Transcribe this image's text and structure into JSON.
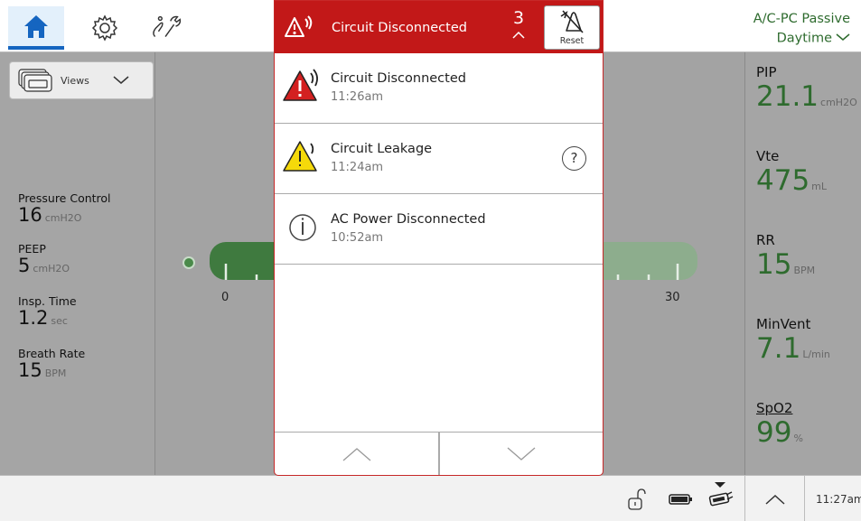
{
  "header": {
    "mode_name": "A/C-PC Passive",
    "schedule": "Daytime",
    "icons": [
      "home-icon",
      "settings-gear-icon",
      "tools-icon"
    ]
  },
  "views": {
    "label": "Views"
  },
  "parameters": [
    {
      "label": "Pressure Control",
      "value": "16",
      "unit": "cmH2O"
    },
    {
      "label": "PEEP",
      "value": "5",
      "unit": "cmH2O"
    },
    {
      "label": "Insp. Time",
      "value": "1.2",
      "unit": "sec"
    },
    {
      "label": "Breath Rate",
      "value": "15",
      "unit": "BPM"
    }
  ],
  "scale": {
    "min": "0",
    "max": "30"
  },
  "measurements": [
    {
      "label": "PIP",
      "value": "21.1",
      "unit": "cmH2O"
    },
    {
      "label": "Vte",
      "value": "475",
      "unit": "mL"
    },
    {
      "label": "RR",
      "value": "15",
      "unit": "BPM"
    },
    {
      "label": "MinVent",
      "value": "7.1",
      "unit": "L/min"
    },
    {
      "label": "SpO2",
      "value": "99",
      "unit": "%"
    }
  ],
  "alarm_panel": {
    "title": "Circuit Disconnected",
    "count": "3",
    "reset_label": "Reset",
    "alarms": [
      {
        "name": "Circuit Disconnected",
        "time": "11:26am",
        "severity": "high"
      },
      {
        "name": "Circuit Leakage",
        "time": "11:24am",
        "severity": "medium"
      },
      {
        "name": "AC Power Disconnected",
        "time": "10:52am",
        "severity": "info"
      }
    ]
  },
  "status_bar": {
    "time": "11:27am"
  },
  "colors": {
    "alarm_red": "#c21818",
    "accent_blue": "#1565c0",
    "value_green": "#2e6b2e",
    "caution_yellow": "#f5d90a"
  }
}
